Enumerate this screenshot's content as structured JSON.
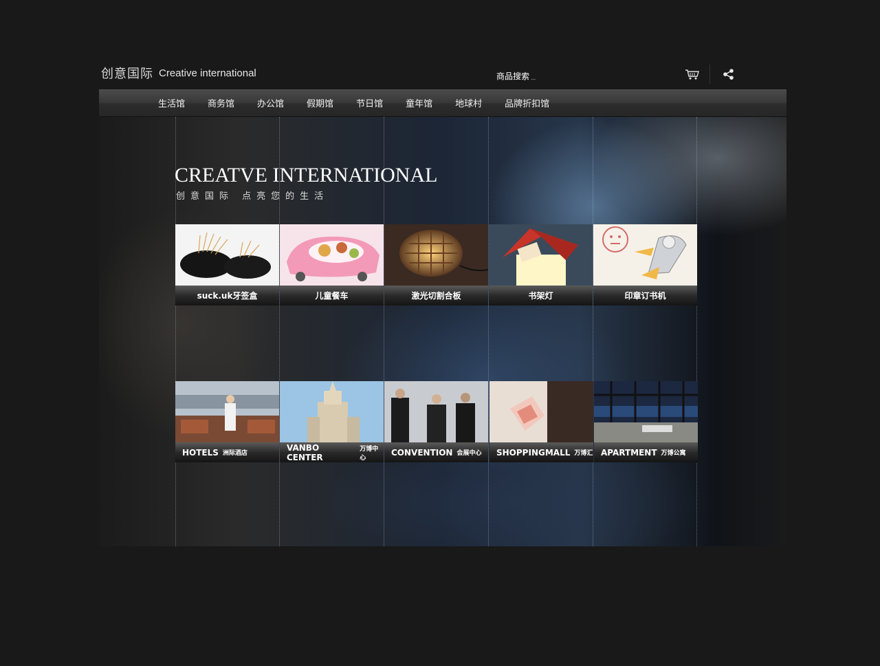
{
  "header": {
    "logo_cn": "创意国际",
    "logo_en": "Creative international",
    "search_label": "商品搜索",
    "search_dots": "..."
  },
  "nav": {
    "items": [
      "生活馆",
      "商务馆",
      "办公馆",
      "假期馆",
      "节日馆",
      "童年馆",
      "地球村",
      "品牌折扣馆"
    ]
  },
  "hero": {
    "title": "CREATVE INTERNATIONAL",
    "subtitle": "创意国际 点亮您的生活"
  },
  "products": [
    {
      "label": "suck.uk牙签盒"
    },
    {
      "label": "儿童餐车"
    },
    {
      "label": "激光切割合板"
    },
    {
      "label": "书架灯"
    },
    {
      "label": "印章订书机"
    }
  ],
  "venues": [
    {
      "label": "HOTELS",
      "sub": "洲际酒店"
    },
    {
      "label": "VANBO CENTER",
      "sub": "万博中心"
    },
    {
      "label": "CONVENTION",
      "sub": "会展中心"
    },
    {
      "label": "SHOPPINGMALL",
      "sub": "万博汇"
    },
    {
      "label": "APARTMENT",
      "sub": "万博公寓"
    }
  ],
  "colors": {
    "page_bg": "#191919",
    "nav_bg": "#333333"
  }
}
